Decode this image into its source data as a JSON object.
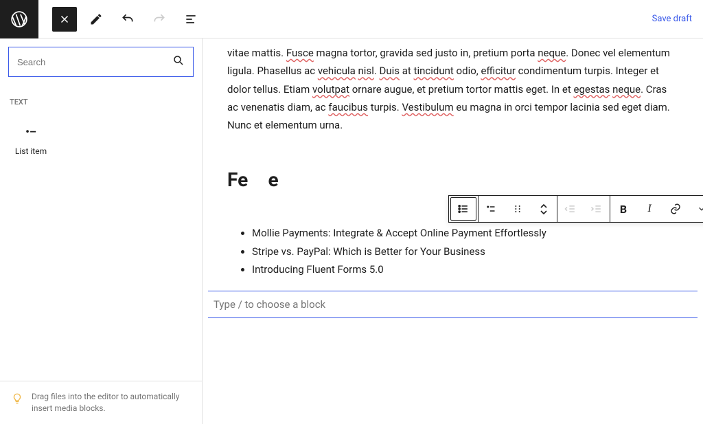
{
  "topbar": {
    "save_draft": "Save draft"
  },
  "sidebar": {
    "search_placeholder": "Search",
    "section_label": "Text",
    "block": {
      "label": "List item"
    },
    "hint": "Drag files into the editor to automatically insert media blocks."
  },
  "editor": {
    "paragraph_parts": [
      {
        "t": "vitae mattis. "
      },
      {
        "t": "Fusce",
        "u": true
      },
      {
        "t": " magna tortor, gravida sed justo in, pretium porta "
      },
      {
        "t": "neque",
        "u": true
      },
      {
        "t": ". Donec vel elementum ligula. Phasellus ac "
      },
      {
        "t": "vehicula",
        "u": true
      },
      {
        "t": " "
      },
      {
        "t": "nisl",
        "u": true
      },
      {
        "t": ". "
      },
      {
        "t": "Duis",
        "u": true
      },
      {
        "t": " at "
      },
      {
        "t": "tincidunt",
        "u": true
      },
      {
        "t": " odio, "
      },
      {
        "t": "efficitur",
        "u": true
      },
      {
        "t": " condimentum turpis. Integer et dolor tellus. Etiam "
      },
      {
        "t": "volutpat",
        "u": true
      },
      {
        "t": " ornare augue, et pretium tortor mattis eget. In et "
      },
      {
        "t": "egestas",
        "u": true
      },
      {
        "t": " "
      },
      {
        "t": "neque",
        "u": true
      },
      {
        "t": ". Cras ac venenatis diam, ac "
      },
      {
        "t": "faucibus",
        "u": true
      },
      {
        "t": " turpis. "
      },
      {
        "t": "Vestibulum",
        "u": true
      },
      {
        "t": " eu magna in orci tempor lacinia sed eget diam. Nunc et elementum urna."
      }
    ],
    "heading_visible_left": "Fe",
    "heading_visible_right": "e",
    "list_items": [
      "Mollie Payments: Integrate & Accept Online Payment Effortlessly",
      "Stripe vs. PayPal: Which is Better for Your Business",
      "Introducing Fluent Forms 5.0"
    ],
    "placeholder": "Type / to choose a block"
  }
}
